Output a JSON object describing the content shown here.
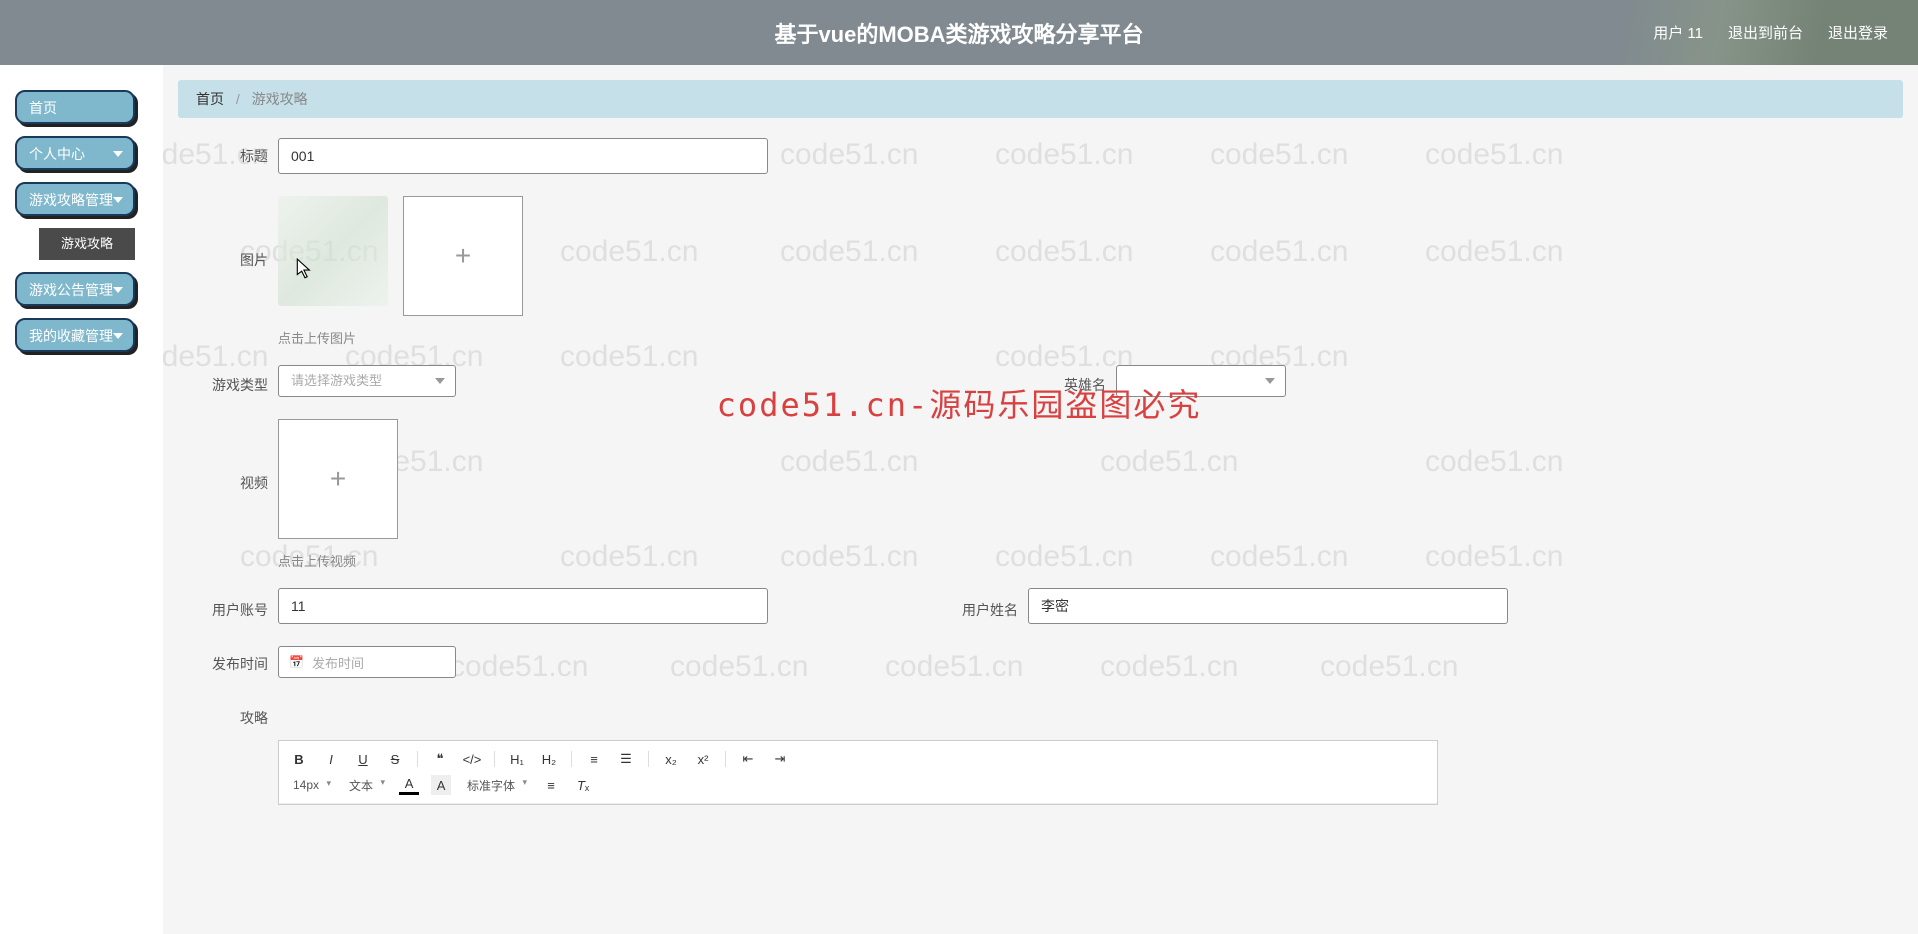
{
  "header": {
    "title": "基于vue的MOBA类游戏攻略分享平台",
    "user_label": "用户 11",
    "exit_front": "退出到前台",
    "logout": "退出登录"
  },
  "sidebar": {
    "home": "首页",
    "personal": "个人中心",
    "strategy_mgmt": "游戏攻略管理",
    "strategy_sub": "游戏攻略",
    "notice_mgmt": "游戏公告管理",
    "favorite_mgmt": "我的收藏管理"
  },
  "breadcrumb": {
    "home": "首页",
    "current": "游戏攻略"
  },
  "form": {
    "title_label": "标题",
    "title_value": "001",
    "image_label": "图片",
    "image_hint": "点击上传图片",
    "game_type_label": "游戏类型",
    "game_type_placeholder": "请选择游戏类型",
    "hero_name_label": "英雄名",
    "hero_name_placeholder": "",
    "video_label": "视频",
    "video_hint": "点击上传视频",
    "account_label": "用户账号",
    "account_value": "11",
    "username_label": "用户姓名",
    "username_value": "李密",
    "publish_label": "发布时间",
    "publish_placeholder": "发布时间",
    "strategy_label": "攻略"
  },
  "editor": {
    "font_size": "14px",
    "font_type": "文本",
    "font_family": "标准字体"
  },
  "watermark": {
    "text": "code51.cn",
    "center": "code51.cn-源码乐园盗图必究"
  }
}
